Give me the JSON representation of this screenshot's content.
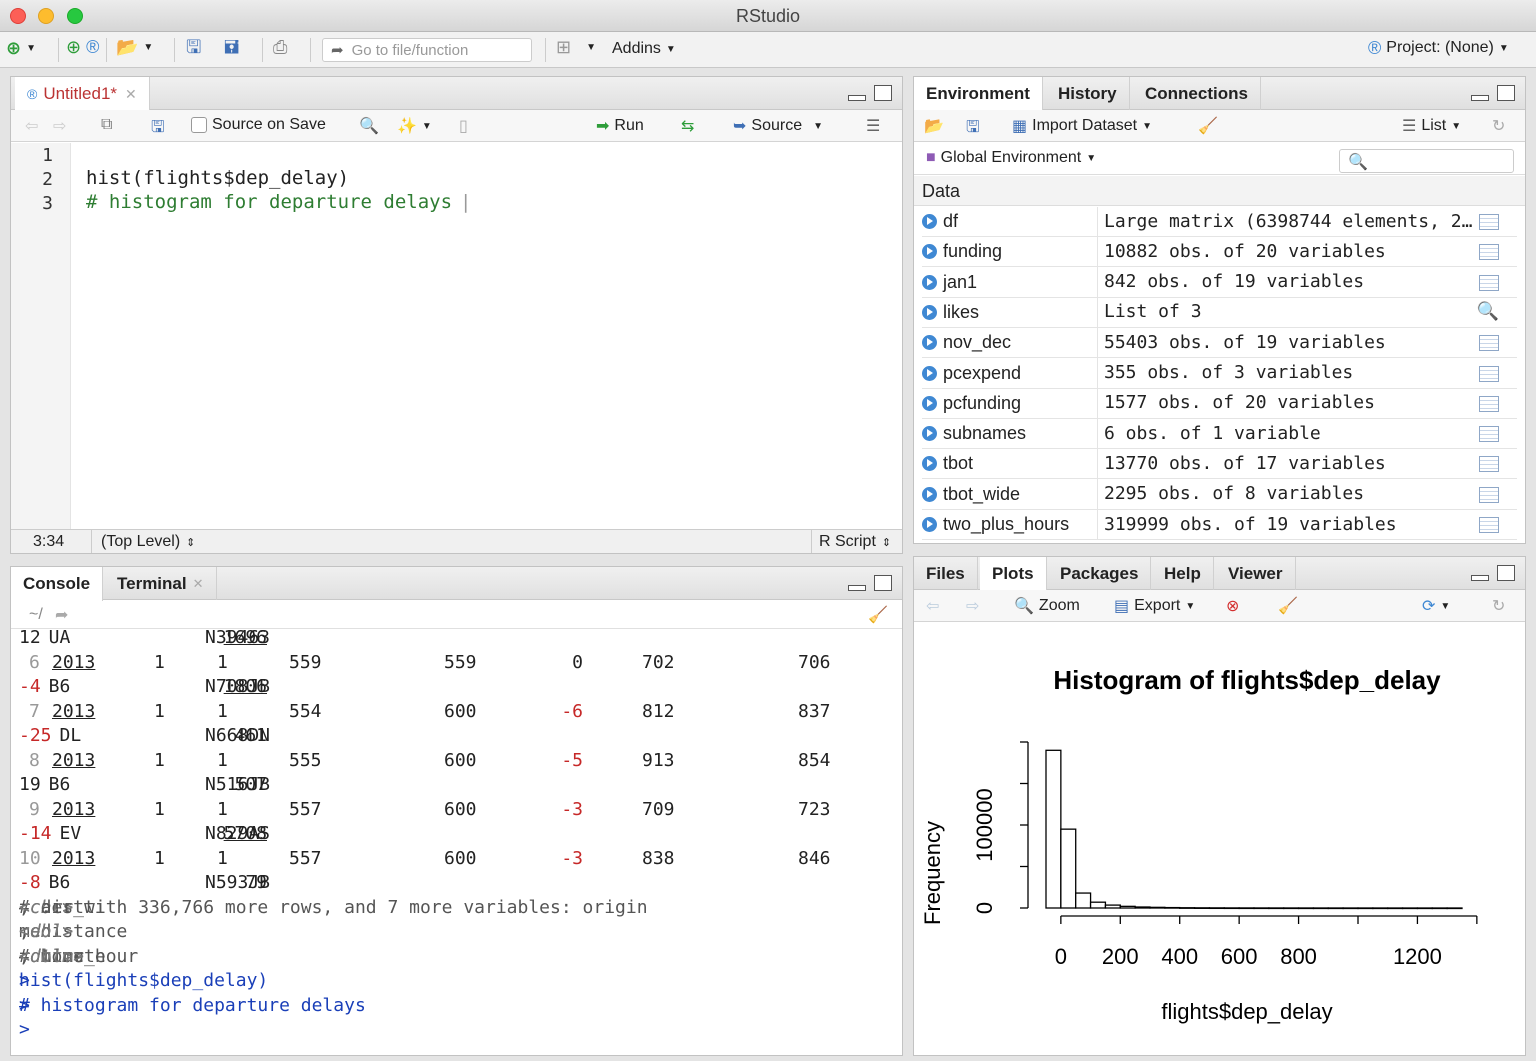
{
  "window": {
    "title": "RStudio"
  },
  "toolbar": {
    "goto_placeholder": "Go to file/function",
    "addins_label": "Addins",
    "project_label": "Project: (None)"
  },
  "editor": {
    "tab_label": "Untitled1*",
    "source_on_save": "Source on Save",
    "run_label": "Run",
    "source_label": "Source",
    "lines": [
      {
        "num": "1",
        "text": ""
      },
      {
        "num": "2",
        "text": "hist(flights$dep_delay)"
      },
      {
        "num": "3",
        "text": "# histogram for departure delays"
      }
    ],
    "cursor_pos": "3:34",
    "scope": "(Top Level)",
    "file_type": "R Script"
  },
  "environment": {
    "tabs": [
      "Environment",
      "History",
      "Connections"
    ],
    "import_label": "Import Dataset",
    "list_label": "List",
    "global_env": "Global Environment",
    "section": "Data",
    "rows": [
      {
        "name": "df",
        "value": "Large matrix (6398744 elements, 24..."
      },
      {
        "name": "funding",
        "value": "10882 obs. of 20 variables"
      },
      {
        "name": "jan1",
        "value": "842 obs. of 19 variables"
      },
      {
        "name": "likes",
        "value": "List of 3"
      },
      {
        "name": "nov_dec",
        "value": "55403 obs. of 19 variables"
      },
      {
        "name": "pcexpend",
        "value": "355 obs. of 3 variables"
      },
      {
        "name": "pcfunding",
        "value": "1577 obs. of 20 variables"
      },
      {
        "name": "subnames",
        "value": "6 obs. of 1 variable"
      },
      {
        "name": "tbot",
        "value": "13770 obs. of 17 variables"
      },
      {
        "name": "tbot_wide",
        "value": "2295 obs. of 8 variables"
      },
      {
        "name": "two_plus_hours",
        "value": "319999 obs. of 19 variables"
      }
    ]
  },
  "console": {
    "tabs": [
      "Console",
      "Terminal"
    ],
    "path": "~/",
    "rows": [
      {
        "a": "12",
        "b": "UA",
        "c": "",
        "d": "1696",
        "e": "N39463"
      },
      {
        "idx": "6",
        "y": "2013",
        "m": "1",
        "d": "1",
        "t1": "559",
        "t2": "559",
        "t3": "0",
        "t4": "702",
        "t5": "706"
      },
      {
        "a": "-4",
        "b": "B6",
        "c": "",
        "d": "1806",
        "e": "N708JB"
      },
      {
        "idx": "7",
        "y": "2013",
        "m": "1",
        "d": "1",
        "t1": "554",
        "t2": "600",
        "t3": "-6",
        "t4": "812",
        "t5": "837"
      },
      {
        "a": "-25",
        "b": "DL",
        "c": "",
        "d": "461",
        "e": "N668DN"
      },
      {
        "idx": "8",
        "y": "2013",
        "m": "1",
        "d": "1",
        "t1": "555",
        "t2": "600",
        "t3": "-5",
        "t4": "913",
        "t5": "854"
      },
      {
        "a": "19",
        "b": "B6",
        "c": "",
        "d": "507",
        "e": "N516JB"
      },
      {
        "idx": "9",
        "y": "2013",
        "m": "1",
        "d": "1",
        "t1": "557",
        "t2": "600",
        "t3": "-3",
        "t4": "709",
        "t5": "723"
      },
      {
        "a": "-14",
        "b": "EV",
        "c": "",
        "d": "5708",
        "e": "N829AS"
      },
      {
        "idx": "10",
        "y": "2013",
        "m": "1",
        "d": "1",
        "t1": "557",
        "t2": "600",
        "t3": "-3",
        "t4": "838",
        "t5": "846"
      },
      {
        "a": "-8",
        "b": "B6",
        "c": "",
        "d": "79",
        "e": "N593JB"
      }
    ],
    "more1_prefix": "# ... with 336,766 more rows, and 7 more variables: origin ",
    "more1_t1": "<chr>",
    "more1_mid": ", dest ",
    "more1_t2": "<chr>",
    "more1_end": ", air_ti",
    "more2_prefix": "me ",
    "more2_t1": "<dbl>",
    "more2_mid": ", distance ",
    "more2_t2": "<dbl>",
    "more2_end": ",",
    "more3_prefix": "#   hour ",
    "more3_t1": "<dbl>",
    "more3_mid": ", minute ",
    "more3_t2": "<dbl>",
    "more3_mid2": ", time_hour ",
    "more3_t3": "<dttm>",
    "cmd1": "hist(flights$dep_delay)",
    "cmd2": "# histogram for departure delays",
    "prompt": ">"
  },
  "files": {
    "tabs": [
      "Files",
      "Plots",
      "Packages",
      "Help",
      "Viewer"
    ],
    "zoom_label": "Zoom",
    "export_label": "Export"
  },
  "chart_data": {
    "type": "bar",
    "title": "Histogram of flights$dep_delay",
    "xlabel": "flights$dep_delay",
    "ylabel": "Frequency",
    "x_bin_edges": [
      -50,
      0,
      50,
      100,
      150,
      200,
      250,
      300,
      350,
      400,
      450,
      500,
      550,
      600,
      650,
      700,
      750,
      800,
      850,
      900,
      950,
      1000,
      1050,
      1100,
      1150,
      1200,
      1250,
      1300,
      1350
    ],
    "values": [
      190000,
      95000,
      18000,
      7000,
      3500,
      2000,
      1200,
      800,
      500,
      300,
      200,
      150,
      100,
      80,
      60,
      50,
      40,
      30,
      25,
      20,
      15,
      12,
      10,
      8,
      6,
      5,
      4,
      3
    ],
    "xticks": [
      "0",
      "200",
      "400",
      "600",
      "800",
      "1200"
    ],
    "xtick_values": [
      0,
      200,
      400,
      600,
      800,
      1200
    ],
    "yticks": [
      "0",
      "100000"
    ],
    "ytick_values": [
      0,
      100000
    ],
    "xlim": [
      -50,
      1350
    ],
    "ylim": [
      0,
      200000
    ]
  },
  "colors": {
    "accent": "#3f88d3",
    "comment": "#2e7d32",
    "negative": "#c62828",
    "command": "#1a3fb8"
  }
}
